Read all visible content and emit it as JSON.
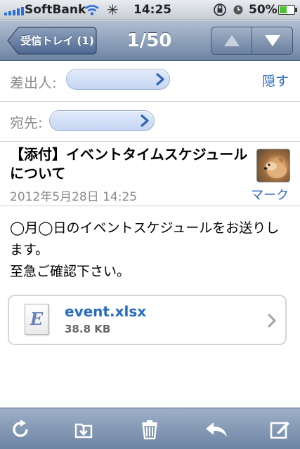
{
  "status_bar": {
    "carrier": "SoftBank",
    "signal_bars": 5,
    "time": "14:25",
    "battery_percent": "50%",
    "battery_level": 0.5,
    "icons": [
      "signal-icon",
      "wifi-icon",
      "activity-spinner-icon",
      "rotation-lock-icon",
      "alarm-icon",
      "battery-icon"
    ]
  },
  "nav": {
    "back_label": "受信トレイ (1)",
    "counter": "1/50",
    "prev_icon": "up-arrow-icon",
    "next_icon": "down-arrow-icon"
  },
  "header": {
    "from_label": "差出人:",
    "to_label": "宛先:",
    "hide_label": "隠す",
    "subject": "【添付】イベントタイムスケジュールについて",
    "date": "2012年5月28日 14:25",
    "mark_label": "マーク"
  },
  "body": {
    "lines": [
      "◯月◯日のイベントスケジュールをお送りし",
      "ます。",
      "至急ご確認下さい。"
    ]
  },
  "attachment": {
    "icon_letter": "E",
    "file_name": "event.xlsx",
    "file_size": "38.8 KB"
  },
  "toolbar": {
    "buttons": [
      "refresh-icon",
      "move-to-folder-icon",
      "trash-icon",
      "reply-icon",
      "compose-icon"
    ]
  },
  "colors": {
    "link": "#2a6cc2",
    "nav_bar": "#7f95b3",
    "pill": "#d3e0f7"
  }
}
